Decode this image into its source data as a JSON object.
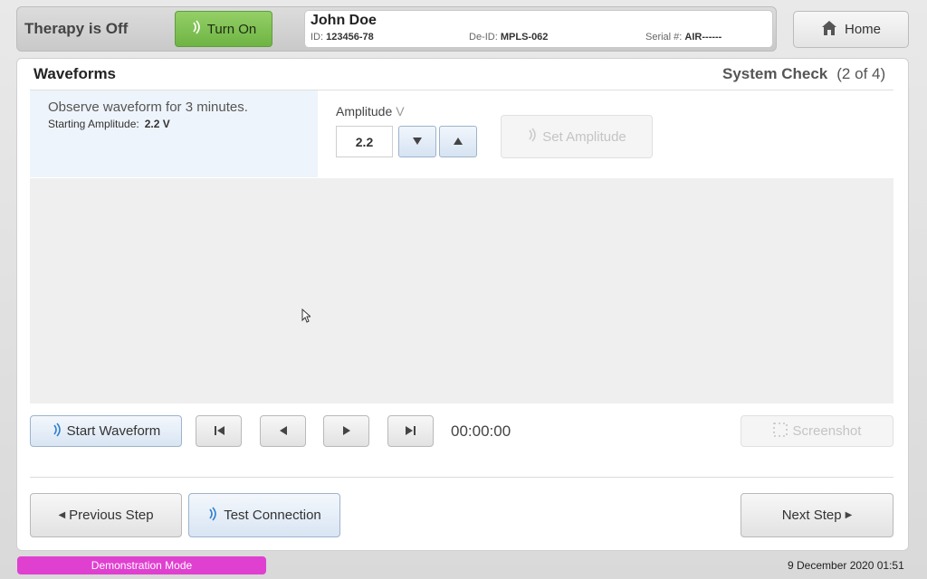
{
  "header": {
    "therapy_status": "Therapy is Off",
    "turn_on_label": "Turn On",
    "home_label": "Home"
  },
  "patient": {
    "name": "John Doe",
    "id_label": "ID:",
    "id_value": "123456-78",
    "deid_label": "De-ID:",
    "deid_value": "MPLS-062",
    "serial_label": "Serial #:",
    "serial_value": "AIR------"
  },
  "page": {
    "title": "Waveforms",
    "step_label": "System Check",
    "step_current": "2",
    "step_of": "of",
    "step_total": "4"
  },
  "instruction": {
    "main": "Observe waveform for 3 minutes.",
    "sub_label": "Starting Amplitude:",
    "sub_value": "2.2 V"
  },
  "amplitude": {
    "label": "Amplitude",
    "unit": "V",
    "value": "2.2",
    "set_label": "Set Amplitude"
  },
  "playback": {
    "start_label": "Start Waveform",
    "time": "00:00:00",
    "screenshot_label": "Screenshot"
  },
  "nav": {
    "previous_label": "Previous Step",
    "test_connection_label": "Test Connection",
    "next_label": "Next Step"
  },
  "footer": {
    "mode": "Demonstration Mode",
    "datetime": "9 December 2020 01:51"
  },
  "colors": {
    "turn_on": "#7dbf4f",
    "demo_badge": "#e040d0",
    "accent_blue": "#2f7fd0"
  },
  "icons": [
    "wireless-icon",
    "home-icon",
    "chevron-down-icon",
    "chevron-up-icon",
    "skip-first-icon",
    "step-back-icon",
    "step-forward-icon",
    "skip-last-icon",
    "screenshot-icon",
    "cursor-icon"
  ]
}
